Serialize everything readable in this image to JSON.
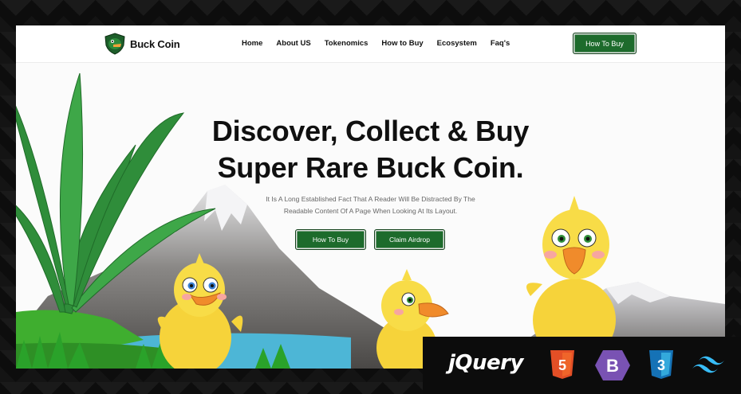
{
  "brand": {
    "name": "Buck Coin",
    "logo_icon": "duck-shield-icon"
  },
  "nav": {
    "items": [
      "Home",
      "About US",
      "Tokenomics",
      "How to Buy",
      "Ecosystem",
      "Faq's"
    ],
    "cta_label": "How To Buy"
  },
  "hero": {
    "title_line1": "Discover, Collect & Buy",
    "title_line2": "Super Rare Buck Coin.",
    "subtitle_line1": "It Is A Long Established Fact That A Reader Will Be Distracted By The",
    "subtitle_line2": "Readable Content Of A Page When Looking At Its Layout.",
    "primary_button": "How To Buy",
    "secondary_button": "Claim Airdrop"
  },
  "tech_stack": {
    "jquery_label": "jQuery",
    "html_label": "5",
    "bootstrap_label": "B",
    "css_label": "3",
    "icons": [
      "jquery-logo-icon",
      "html5-icon",
      "bootstrap-icon",
      "css3-icon",
      "tailwind-icon"
    ]
  },
  "colors": {
    "accent": "#1d6b2c",
    "text": "#101010",
    "background": "#ffffff",
    "frame": "#0d0d0d"
  }
}
